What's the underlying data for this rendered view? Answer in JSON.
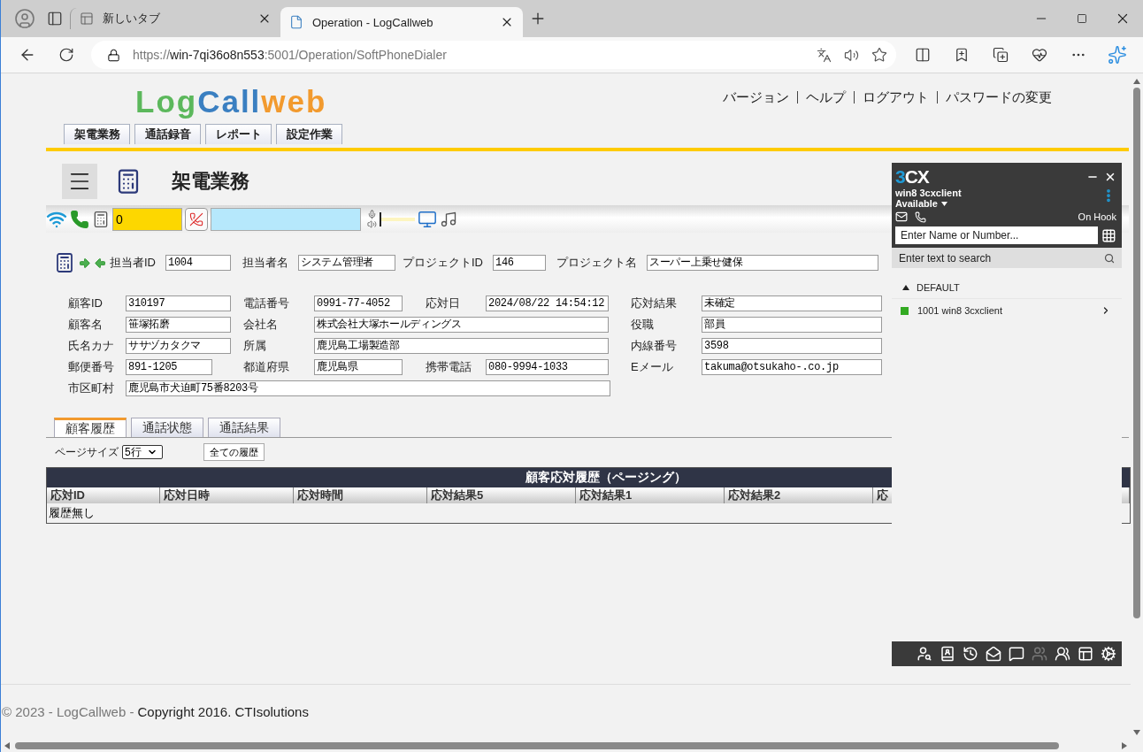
{
  "browser": {
    "tabs": [
      {
        "title": "新しいタブ",
        "selected": false
      },
      {
        "title": "Operation - LogCallweb",
        "selected": true
      }
    ],
    "url": {
      "scheme": "https://",
      "host": "win-7qi36o8n553",
      "path": ":5001/Operation/SoftPhoneDialer"
    }
  },
  "header": {
    "logo": [
      {
        "text": "Log",
        "color": "#5cb85c"
      },
      {
        "text": "Call",
        "color": "#3a7fc1"
      },
      {
        "text": "web",
        "color": "#f29a2e"
      }
    ],
    "links": [
      "バージョン",
      "ヘルプ",
      "ログアウト",
      "パスワードの変更"
    ]
  },
  "menu_tabs": [
    "架電業務",
    "通話録音",
    "レポート",
    "設定作業"
  ],
  "page_title": "架電業務",
  "phone_bar": {
    "call_count": "0",
    "volume": {
      "level": 0
    }
  },
  "agent": [
    {
      "label": "担当者ID",
      "value": "1004"
    },
    {
      "label": "担当者名",
      "value": "システム管理者"
    },
    {
      "label": "プロジェクトID",
      "value": "146"
    },
    {
      "label": "プロジェクト名",
      "value": "スーパー上乗せ健保"
    }
  ],
  "customer": {
    "rows": [
      [
        {
          "label": "顧客ID",
          "value": "310197"
        },
        {
          "label": "電話番号",
          "value": "0991-77-4052"
        },
        {
          "label": "応対日",
          "value": "2024/08/22 14:54:12"
        },
        {
          "label": "応対結果",
          "value": "未確定"
        }
      ],
      [
        {
          "label": "顧客名",
          "value": "笹塚拓磨"
        },
        {
          "label": "会社名",
          "value": "株式会社大塚ホールディングス"
        },
        {
          "label": "役職",
          "value": "部員"
        }
      ],
      [
        {
          "label": "氏名カナ",
          "value": "ササヅカタクマ"
        },
        {
          "label": "所属",
          "value": "鹿児島工場製造部"
        },
        {
          "label": "内線番号",
          "value": "3598"
        }
      ],
      [
        {
          "label": "郵便番号",
          "value": "891-1205"
        },
        {
          "label": "都道府県",
          "value": "鹿児島県"
        },
        {
          "label": "携帯電話",
          "value": "080-9994-1033"
        },
        {
          "label": "Eメール",
          "value": "takuma@otsukaho-.co.jp"
        }
      ],
      [
        {
          "label": "市区町村",
          "value": "鹿児島市犬迫町75番8203号"
        }
      ]
    ]
  },
  "detail_tabs": [
    {
      "label": "顧客履歴",
      "selected": true
    },
    {
      "label": "通話状態",
      "selected": false
    },
    {
      "label": "通話結果",
      "selected": false
    }
  ],
  "history": {
    "page_size_label": "ページサイズ",
    "page_size": "5行",
    "all_button": "全ての履歴",
    "title": "顧客応対履歴（ページング）",
    "columns": [
      "応対ID",
      "応対日時",
      "応対時間",
      "応対結果5",
      "応対結果1",
      "応対結果2",
      "応"
    ],
    "empty_text": "履歴無し"
  },
  "softphone": {
    "brand": {
      "accent": "3",
      "rest": "CX"
    },
    "user": "win8 3cxclient",
    "status": "Available",
    "hook_state": "On Hook",
    "dial_placeholder": "Enter Name or Number...",
    "search_placeholder": "Enter text to search",
    "groups": [
      {
        "name": "DEFAULT",
        "expanded": true,
        "contacts": [
          {
            "name": "1001 win8 3cxclient",
            "color": "#33aa22"
          }
        ]
      }
    ],
    "toolbar": [
      {
        "kind": "presence",
        "disabled": false
      },
      {
        "kind": "phonebook",
        "disabled": false
      },
      {
        "kind": "history",
        "disabled": false
      },
      {
        "kind": "voicemail",
        "disabled": false
      },
      {
        "kind": "chat",
        "disabled": false
      },
      {
        "kind": "group",
        "disabled": true
      },
      {
        "kind": "conference",
        "disabled": false
      },
      {
        "kind": "switchboard",
        "disabled": false
      },
      {
        "kind": "settings",
        "disabled": false
      }
    ]
  },
  "footer": {
    "notice": "© 2023 - LogCallweb -",
    "copyright": "Copyright 2016. CTIsolutions"
  }
}
